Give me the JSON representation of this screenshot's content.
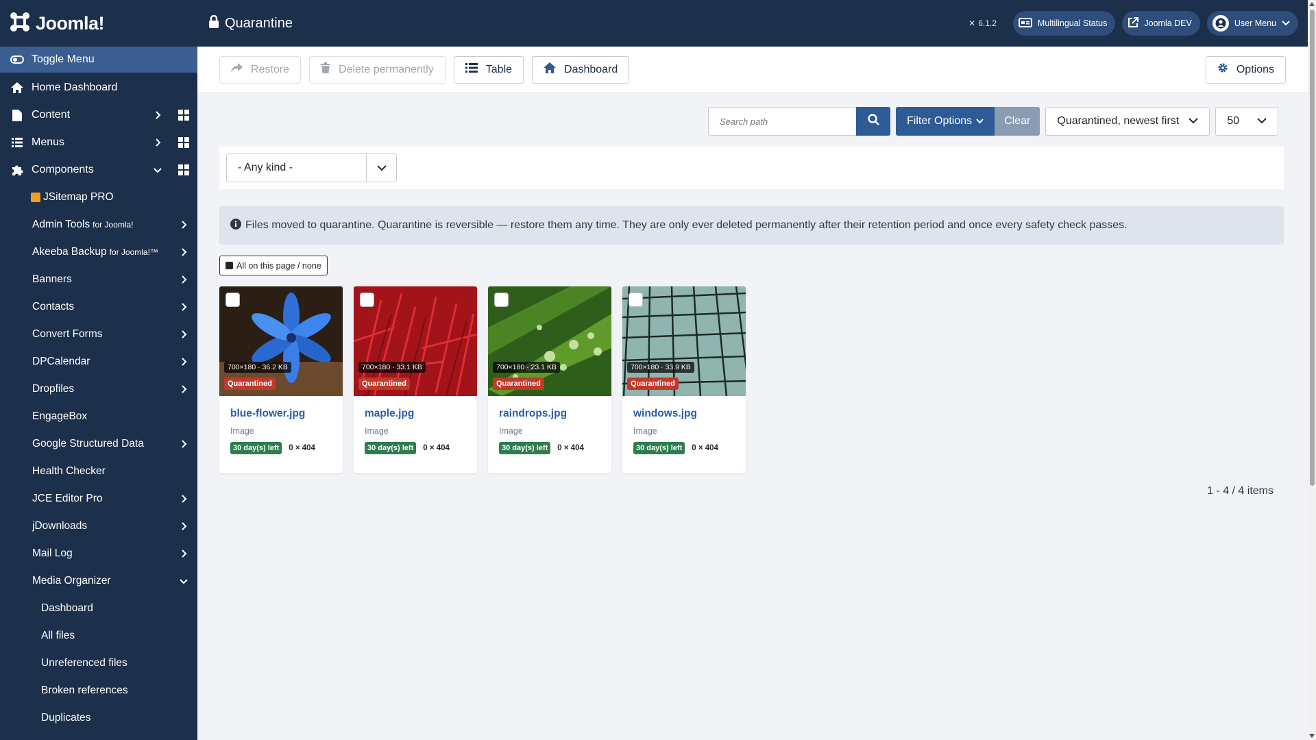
{
  "brand": {
    "logo_text": "Joomla!"
  },
  "sidebar": {
    "toggle_label": "Toggle Menu",
    "top_items": [
      {
        "label": "Home Dashboard"
      },
      {
        "label": "Content"
      },
      {
        "label": "Menus"
      },
      {
        "label": "Components"
      }
    ],
    "components": [
      {
        "label": "JSitemap PRO",
        "suffix": ""
      },
      {
        "label": "Admin Tools",
        "suffix": "for Joomla!"
      },
      {
        "label": "Akeeba Backup",
        "suffix": "for Joomla!™"
      },
      {
        "label": "Banners",
        "suffix": ""
      },
      {
        "label": "Contacts",
        "suffix": ""
      },
      {
        "label": "Convert Forms",
        "suffix": ""
      },
      {
        "label": "DPCalendar",
        "suffix": ""
      },
      {
        "label": "Dropfiles",
        "suffix": ""
      },
      {
        "label": "EngageBox",
        "suffix": ""
      },
      {
        "label": "Google Structured Data",
        "suffix": ""
      },
      {
        "label": "Health Checker",
        "suffix": ""
      },
      {
        "label": "JCE Editor Pro",
        "suffix": ""
      },
      {
        "label": "jDownloads",
        "suffix": ""
      },
      {
        "label": "Mail Log",
        "suffix": ""
      },
      {
        "label": "Media Organizer",
        "suffix": ""
      }
    ],
    "media_organizer_items": [
      {
        "label": "Dashboard"
      },
      {
        "label": "All files"
      },
      {
        "label": "Unreferenced files"
      },
      {
        "label": "Broken references"
      },
      {
        "label": "Duplicates"
      }
    ]
  },
  "header": {
    "title": "Quarantine",
    "version": "6.1.2",
    "multilingual_label": "Multilingual Status",
    "site_label": "Joomla DEV",
    "user_label": "User Menu"
  },
  "toolbar": {
    "restore_label": "Restore",
    "delete_label": "Delete permanently",
    "table_label": "Table",
    "dashboard_label": "Dashboard",
    "options_label": "Options"
  },
  "filters": {
    "search_placeholder": "Search path",
    "filter_options_label": "Filter Options",
    "clear_label": "Clear",
    "sort_value": "Quarantined, newest first",
    "limit_value": "50",
    "kind_value": "- Any kind -"
  },
  "info_text": "Files moved to quarantine. Quarantine is reversible — restore them any time. They are only ever deleted permanently after their retention period and once every safety check passes.",
  "select_all_label": "All on this page / none",
  "cards": [
    {
      "name": "blue-flower.jpg",
      "kind": "Image",
      "dims_badge": "700×180 · 36.2 KB",
      "status": "Quarantined",
      "days_left": "30 day(s) left",
      "dimensions": "0 × 404"
    },
    {
      "name": "maple.jpg",
      "kind": "Image",
      "dims_badge": "700×180 · 33.1 KB",
      "status": "Quarantined",
      "days_left": "30 day(s) left",
      "dimensions": "0 × 404"
    },
    {
      "name": "raindrops.jpg",
      "kind": "Image",
      "dims_badge": "700×180 · 23.1 KB",
      "status": "Quarantined",
      "days_left": "30 day(s) left",
      "dimensions": "0 × 404"
    },
    {
      "name": "windows.jpg",
      "kind": "Image",
      "dims_badge": "700×180 · 33.9 KB",
      "status": "Quarantined",
      "days_left": "30 day(s) left",
      "dimensions": "0 × 404"
    }
  ],
  "pagination_text": "1 - 4 / 4 items",
  "colors": {
    "sidebar_bg": "#1c2f4b",
    "accent": "#2e5b95",
    "quarantine_red": "#c0392b",
    "days_green": "#2e7d4f",
    "link_blue": "#2a5fa8"
  }
}
